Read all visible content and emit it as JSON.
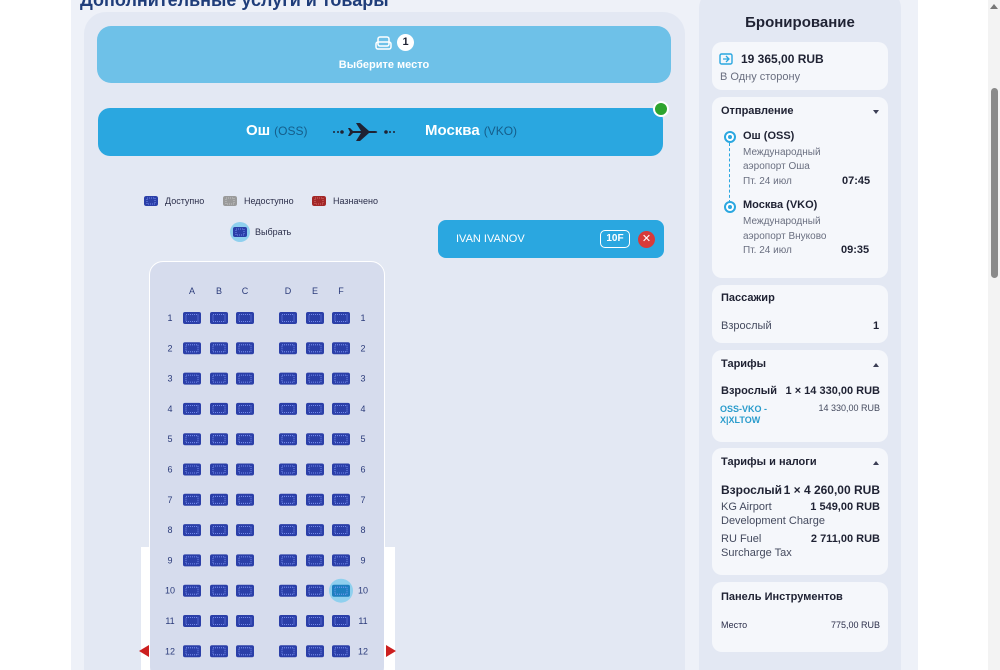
{
  "section_title": "Дополнительные услуги и товары",
  "seat_selection": {
    "count": "1",
    "label": "Выберите место",
    "icon": "seat-icon"
  },
  "route": {
    "from_city": "Ош",
    "from_code": "(OSS)",
    "to_city": "Москва",
    "to_code": "(VKO)",
    "icon": "plane-icon"
  },
  "legend": {
    "available": "Доступно",
    "unavailable": "Недоступно",
    "assigned": "Назначено",
    "select": "Выбрать"
  },
  "passenger": {
    "name": "IVAN IVANOV",
    "seat": "10F",
    "remove_icon": "close-icon"
  },
  "seat_map": {
    "left_columns": [
      "A",
      "B",
      "C"
    ],
    "right_columns": [
      "D",
      "E",
      "F"
    ],
    "rows": [
      "1",
      "2",
      "3",
      "4",
      "5",
      "6",
      "7",
      "8",
      "9",
      "10",
      "11",
      "12"
    ],
    "selected_seat": {
      "row": "10",
      "column": "F"
    },
    "exit_row": "12"
  },
  "booking": {
    "title": "Бронирование",
    "total_price": "19 365,00 RUB",
    "trip_type": "В Одну сторону",
    "departure": {
      "title": "Отправление",
      "origin": {
        "city": "Ош (OSS)",
        "airport_line1": "Международный",
        "airport_line2": "аэропорт Оша",
        "date": "Пт. 24 июл",
        "time": "07:45"
      },
      "destination": {
        "city": "Москва (VKO)",
        "airport_line1": "Международный",
        "airport_line2": "аэропорт Внуково",
        "date": "Пт. 24 июл",
        "time": "09:35"
      }
    },
    "passenger": {
      "title": "Пассажир",
      "type": "Взрослый",
      "count": "1"
    },
    "tariffs": {
      "title": "Тарифы",
      "type": "Взрослый",
      "amount": "1 × 14 330,00 RUB",
      "fare_code": "OSS-VKO - X|XLTOW",
      "fare_amount": "14 330,00 RUB"
    },
    "taxes": {
      "title": "Тарифы и налоги",
      "type": "Взрослый",
      "amount": "1 × 4 260,00 RUB",
      "items": [
        {
          "name_line1": "KG Airport",
          "name_line2": "Development Charge",
          "amount": "1 549,00 RUB"
        },
        {
          "name_line1": "RU Fuel",
          "name_line2": "Surcharge Tax",
          "amount": "2 711,00 RUB"
        }
      ]
    },
    "tools": {
      "title": "Панель Инструментов",
      "item_label": "Место",
      "item_amount": "775,00 RUB"
    }
  },
  "colors": {
    "seat_available": "#2b3fa8",
    "seat_unavailable": "#9a9a9a",
    "seat_assigned": "#a32727",
    "accent": "#2aa7e0",
    "select_bar": "#6ec1e8",
    "status_online": "#2ea42e",
    "remove": "#d83a3a",
    "exit_marker": "#cc1f1f"
  }
}
